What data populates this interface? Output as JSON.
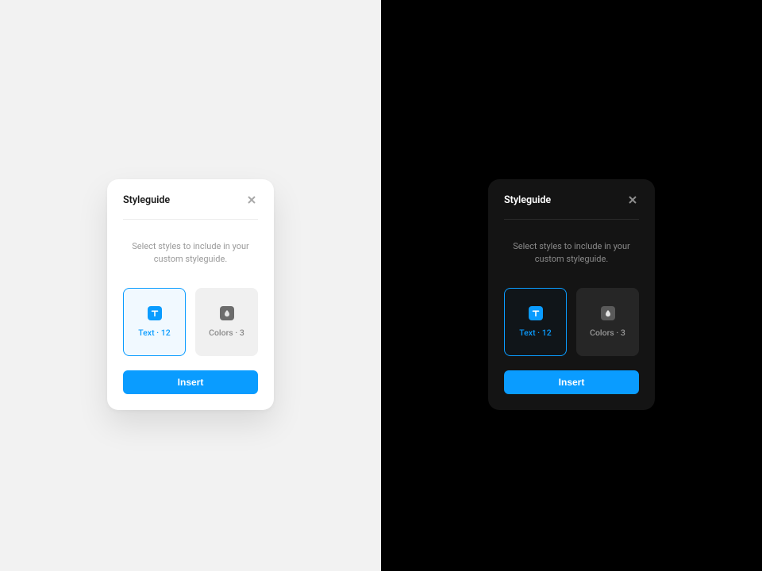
{
  "dialog": {
    "title": "Styleguide",
    "instruction": "Select styles to include in your custom styleguide.",
    "insert_label": "Insert"
  },
  "tiles": {
    "text": {
      "label": "Text · 12",
      "selected": true
    },
    "colors": {
      "label": "Colors · 3",
      "selected": false
    }
  },
  "colors": {
    "accent": "#0a9cff"
  }
}
